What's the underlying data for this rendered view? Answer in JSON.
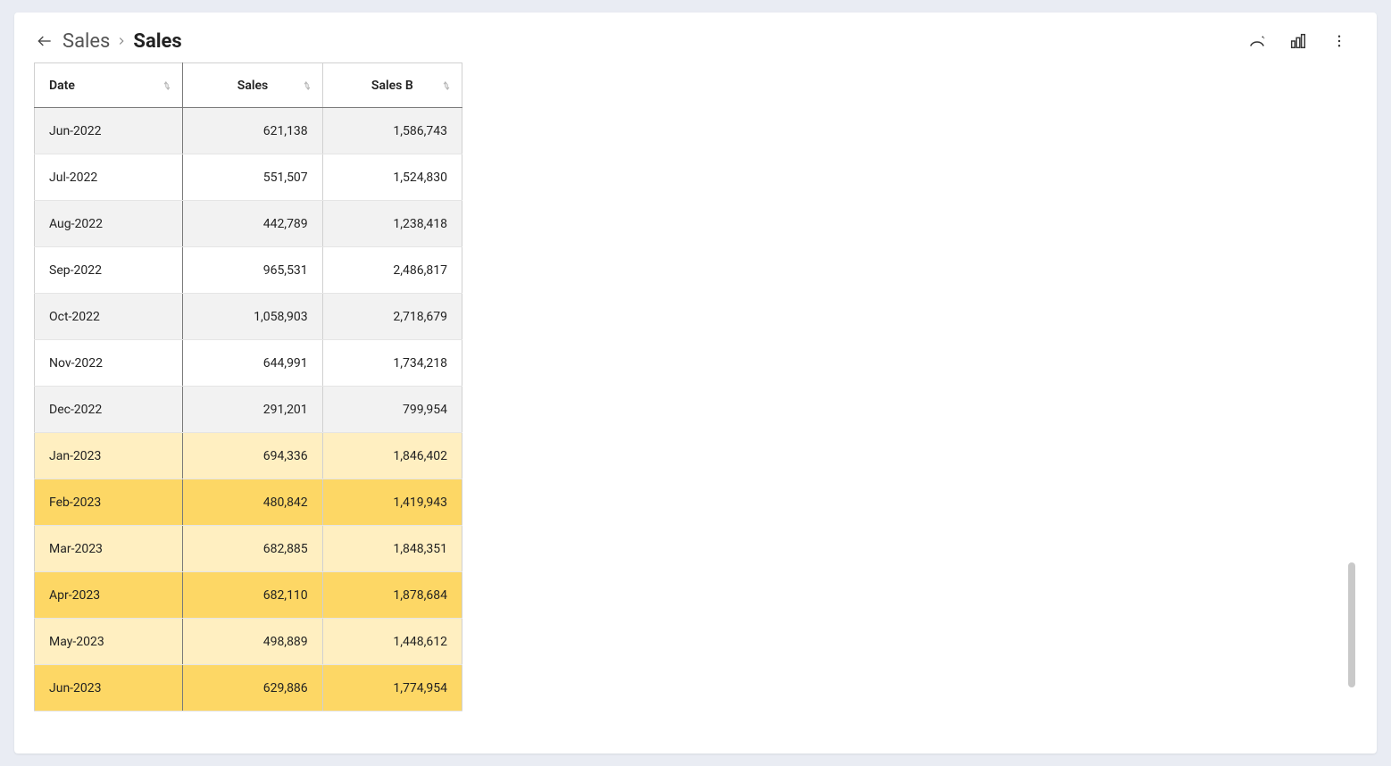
{
  "header": {
    "breadcrumb_root": "Sales",
    "breadcrumb_current": "Sales"
  },
  "table": {
    "columns": {
      "date": "Date",
      "sales": "Sales",
      "salesb": "Sales B"
    },
    "rows": [
      {
        "date": "Jun-2022",
        "sales": "621,138",
        "salesb": "1,586,743",
        "style": "stripe-light"
      },
      {
        "date": "Jul-2022",
        "sales": "551,507",
        "salesb": "1,524,830",
        "style": "stripe-white"
      },
      {
        "date": "Aug-2022",
        "sales": "442,789",
        "salesb": "1,238,418",
        "style": "stripe-light"
      },
      {
        "date": "Sep-2022",
        "sales": "965,531",
        "salesb": "2,486,817",
        "style": "stripe-white"
      },
      {
        "date": "Oct-2022",
        "sales": "1,058,903",
        "salesb": "2,718,679",
        "style": "stripe-light"
      },
      {
        "date": "Nov-2022",
        "sales": "644,991",
        "salesb": "1,734,218",
        "style": "stripe-white"
      },
      {
        "date": "Dec-2022",
        "sales": "291,201",
        "salesb": "799,954",
        "style": "stripe-light"
      },
      {
        "date": "Jan-2023",
        "sales": "694,336",
        "salesb": "1,846,402",
        "style": "hl-light"
      },
      {
        "date": "Feb-2023",
        "sales": "480,842",
        "salesb": "1,419,943",
        "style": "hl-dark"
      },
      {
        "date": "Mar-2023",
        "sales": "682,885",
        "salesb": "1,848,351",
        "style": "hl-light"
      },
      {
        "date": "Apr-2023",
        "sales": "682,110",
        "salesb": "1,878,684",
        "style": "hl-dark"
      },
      {
        "date": "May-2023",
        "sales": "498,889",
        "salesb": "1,448,612",
        "style": "hl-light"
      },
      {
        "date": "Jun-2023",
        "sales": "629,886",
        "salesb": "1,774,954",
        "style": "hl-dark"
      }
    ]
  },
  "chart_data": {
    "type": "table",
    "columns": [
      "Date",
      "Sales",
      "Sales B"
    ],
    "rows": [
      [
        "Jun-2022",
        621138,
        1586743
      ],
      [
        "Jul-2022",
        551507,
        1524830
      ],
      [
        "Aug-2022",
        442789,
        1238418
      ],
      [
        "Sep-2022",
        965531,
        2486817
      ],
      [
        "Oct-2022",
        1058903,
        2718679
      ],
      [
        "Nov-2022",
        644991,
        1734218
      ],
      [
        "Dec-2022",
        291201,
        799954
      ],
      [
        "Jan-2023",
        694336,
        1846402
      ],
      [
        "Feb-2023",
        480842,
        1419943
      ],
      [
        "Mar-2023",
        682885,
        1848351
      ],
      [
        "Apr-2023",
        682110,
        1878684
      ],
      [
        "May-2023",
        498889,
        1448612
      ],
      [
        "Jun-2023",
        629886,
        1774954
      ]
    ]
  }
}
